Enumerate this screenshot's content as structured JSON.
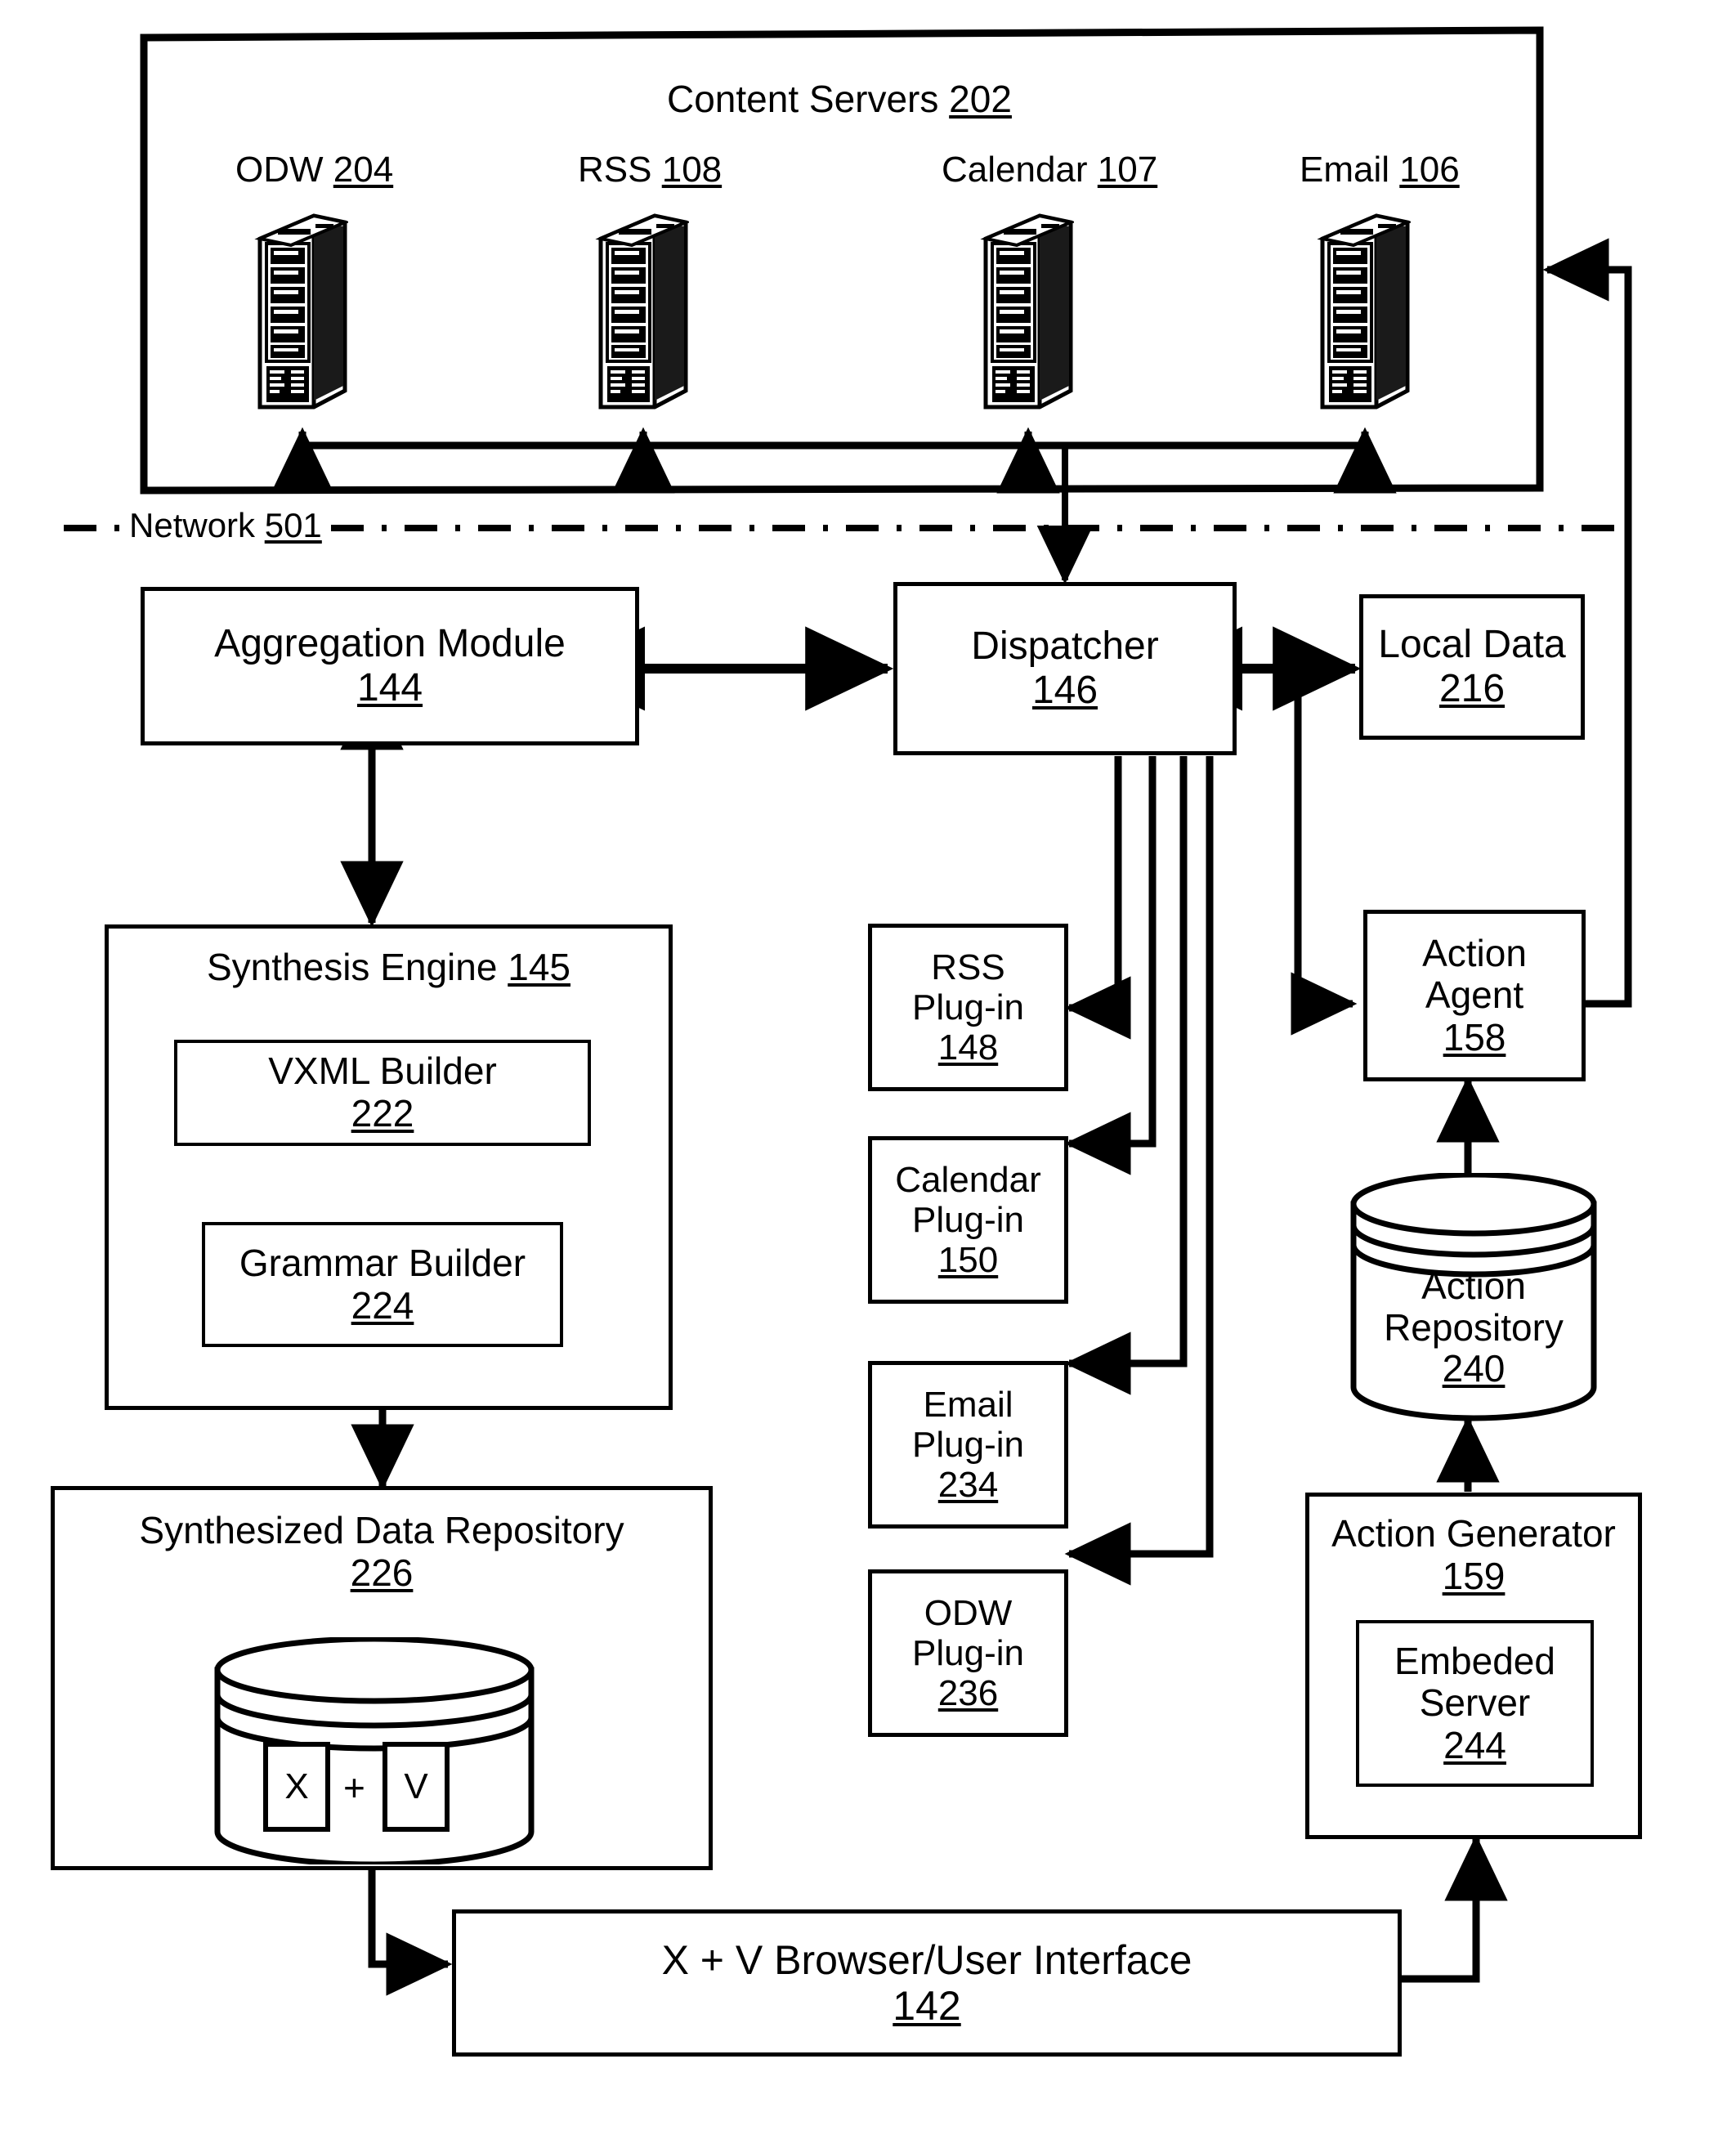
{
  "figure": {
    "network_label": "Network",
    "network_num": "501"
  },
  "content_servers": {
    "title": "Content Servers",
    "title_num": "202",
    "servers": [
      {
        "label": "ODW",
        "num": "204",
        "icon": "server-rack-icon"
      },
      {
        "label": "RSS",
        "num": "108",
        "icon": "server-rack-icon"
      },
      {
        "label": "Calendar",
        "num": "107",
        "icon": "server-rack-icon"
      },
      {
        "label": "Email",
        "num": "106",
        "icon": "server-rack-icon"
      }
    ]
  },
  "blocks": {
    "aggregation_module": {
      "label": "Aggregation Module",
      "num": "144"
    },
    "dispatcher": {
      "label": "Dispatcher",
      "num": "146"
    },
    "local_data": {
      "label": "Local Data",
      "num": "216"
    },
    "synthesis_engine": {
      "label": "Synthesis Engine",
      "num": "145"
    },
    "vxml_builder": {
      "label": "VXML Builder",
      "num": "222"
    },
    "grammar_builder": {
      "label": "Grammar Builder",
      "num": "224"
    },
    "synthesized_data_repository": {
      "label": "Synthesized Data Repository",
      "num": "226"
    },
    "action_agent": {
      "label_line1": "Action",
      "label_line2": "Agent",
      "num": "158"
    },
    "action_repository": {
      "label_line1": "Action",
      "label_line2": "Repository",
      "num": "240"
    },
    "action_generator": {
      "label": "Action Generator",
      "num": "159"
    },
    "embeded_server": {
      "label_line1": "Embeded",
      "label_line2": "Server",
      "num": "244"
    },
    "browser_ui": {
      "label": "X + V Browser/User Interface",
      "num": "142"
    }
  },
  "plugins": [
    {
      "label_line1": "RSS",
      "label_line2": "Plug-in",
      "num": "148"
    },
    {
      "label_line1": "Calendar",
      "label_line2": "Plug-in",
      "num": "150"
    },
    {
      "label_line1": "Email",
      "label_line2": "Plug-in",
      "num": "234"
    },
    {
      "label_line1": "ODW",
      "label_line2": "Plug-in",
      "num": "236"
    }
  ],
  "repository_chips": {
    "left": "X",
    "operator": "+",
    "right": "V"
  },
  "colors": {
    "ink": "#000000",
    "paper": "#ffffff"
  }
}
